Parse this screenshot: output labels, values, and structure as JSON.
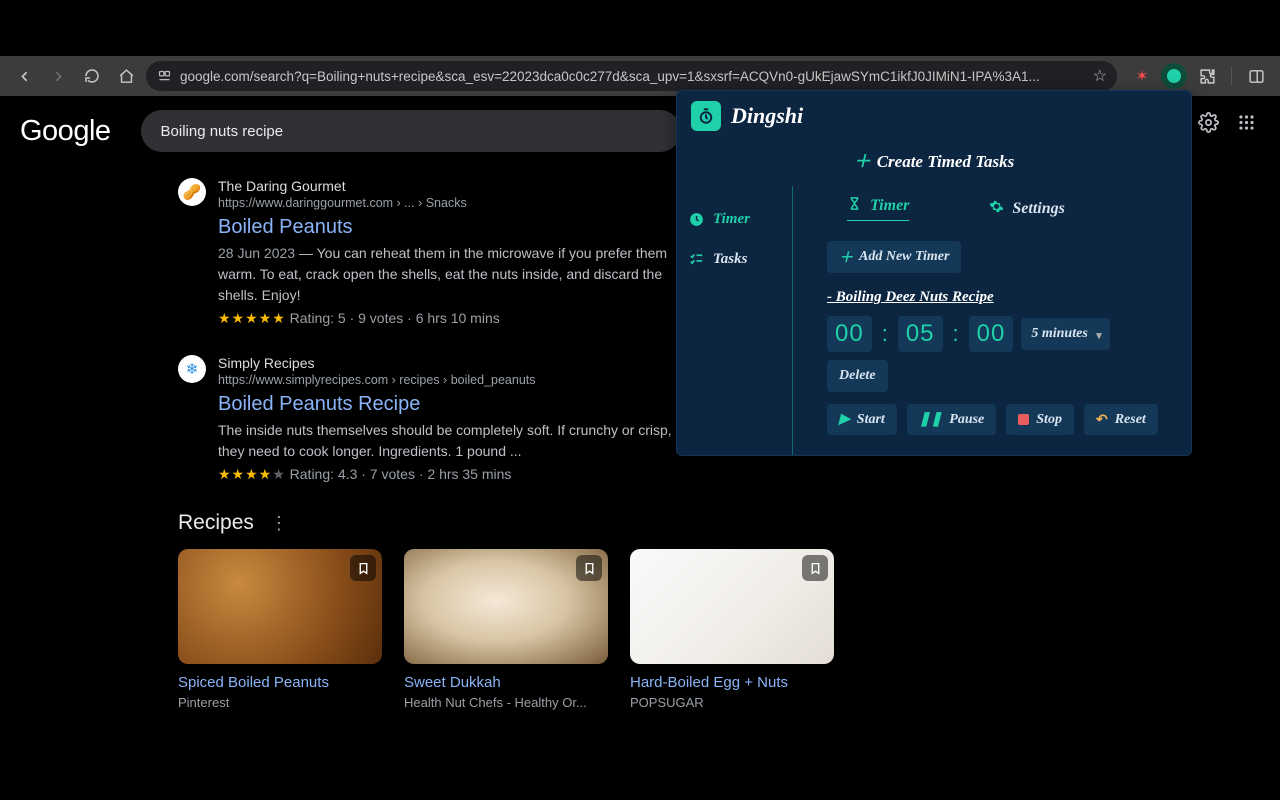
{
  "chrome": {
    "url": "google.com/search?q=Boiling+nuts+recipe&sca_esv=22023dca0c0c277d&sca_upv=1&sxsrf=ACQVn0-gUkEjawSYmC1ikfJ0JIMiN1-IPA%3A1..."
  },
  "google": {
    "logo": "Google",
    "search_value": "Boiling nuts recipe"
  },
  "results": [
    {
      "site": "The Daring Gourmet",
      "url": "https://www.daringgourmet.com › ... › Snacks",
      "title": "Boiled Peanuts",
      "date": "28 Jun 2023",
      "snippet": " — You can reheat them in the microwave if you prefer them warm. To eat, crack open the shells, eat the nuts inside, and discard the shells. Enjoy!",
      "rating": "Rating: 5 · 9 votes · 6 hrs 10 mins",
      "stars_full": 5,
      "stars_blank": 0
    },
    {
      "site": "Simply Recipes",
      "url": "https://www.simplyrecipes.com › recipes › boiled_peanuts",
      "title": "Boiled Peanuts Recipe",
      "date": "",
      "snippet": "The inside nuts themselves should be completely soft. If crunchy or crisp, they need to cook longer. Ingredients. 1 pound ...",
      "rating": "Rating: 4.3 · 7 votes · 2 hrs 35 mins",
      "stars_full": 4,
      "stars_blank": 1
    }
  ],
  "recipes_heading": "Recipes",
  "recipe_cards": [
    {
      "title": "Spiced Boiled Peanuts",
      "source": "Pinterest"
    },
    {
      "title": "Sweet Dukkah",
      "source": "Health Nut Chefs - Healthy Or..."
    },
    {
      "title": "Hard-Boiled Egg + Nuts",
      "source": "POPSUGAR"
    }
  ],
  "dingshi": {
    "app_name": "Dingshi",
    "create_label": "Create Timed Tasks",
    "nav": {
      "timer": "Timer",
      "tasks": "Tasks"
    },
    "tabs": {
      "timer": "Timer",
      "settings": "Settings"
    },
    "add_timer": "Add New Timer",
    "task_title": "- Boiling Deez Nuts Recipe",
    "time": {
      "hh": "00",
      "mm": "05",
      "ss": "00"
    },
    "preset_selected": "5 minutes",
    "delete": "Delete",
    "controls": {
      "start": "Start",
      "pause": "Pause",
      "stop": "Stop",
      "reset": "Reset"
    }
  }
}
